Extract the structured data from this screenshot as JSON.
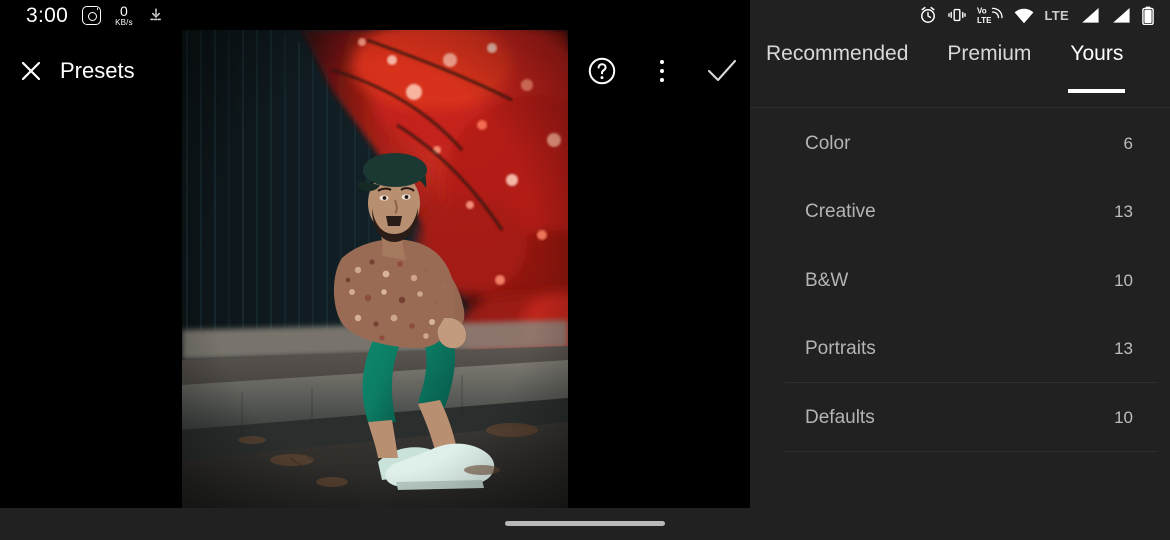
{
  "status_bar": {
    "time": "3:00",
    "instagram_icon": "instagram-icon",
    "net_speed_value": "0",
    "net_speed_unit": "KB/s",
    "download_icon": "download-activity-icon",
    "alarm_icon": "alarm-clock-icon",
    "vibrate_icon": "vibrate-icon",
    "volte_line1": "Vo",
    "volte_line2": "LTE",
    "wifi_icon": "wifi-icon",
    "network_type": "LTE",
    "signal_icon_1": "signal-bars-icon",
    "signal_icon_2": "signal-bars-icon",
    "battery_icon": "battery-icon"
  },
  "toolbar": {
    "close_label": "close-icon",
    "title": "Presets",
    "help_label": "help-icon",
    "overflow_label": "more-options-icon",
    "confirm_label": "checkmark-icon"
  },
  "photo": {
    "alt": "man sitting on curb under red leaved tree"
  },
  "panel": {
    "tabs": [
      {
        "label": "Recommended",
        "active": false
      },
      {
        "label": "Premium",
        "active": false
      },
      {
        "label": "Yours",
        "active": true
      }
    ],
    "presets": [
      {
        "name": "Color",
        "count": "6",
        "divider": false,
        "clipped": false
      },
      {
        "name": "Creative",
        "count": "13",
        "divider": false,
        "clipped": false
      },
      {
        "name": "B&W",
        "count": "10",
        "divider": false,
        "clipped": false
      },
      {
        "name": "Portraits",
        "count": "13",
        "divider": true,
        "clipped": false
      },
      {
        "name": "Defaults",
        "count": "10",
        "divider": true,
        "clipped": false
      },
      {
        "name": "",
        "count": "",
        "divider": false,
        "clipped": true
      }
    ]
  },
  "navbar": {
    "gesture_pill": "home-gesture-pill"
  },
  "colors": {
    "canvas_background": "#000000",
    "panel_background": "#212121",
    "navbar_background": "#212121",
    "accent_underline": "#ffffff",
    "preset_text": "#b4b4b4",
    "divider": "#2e2e2e"
  }
}
